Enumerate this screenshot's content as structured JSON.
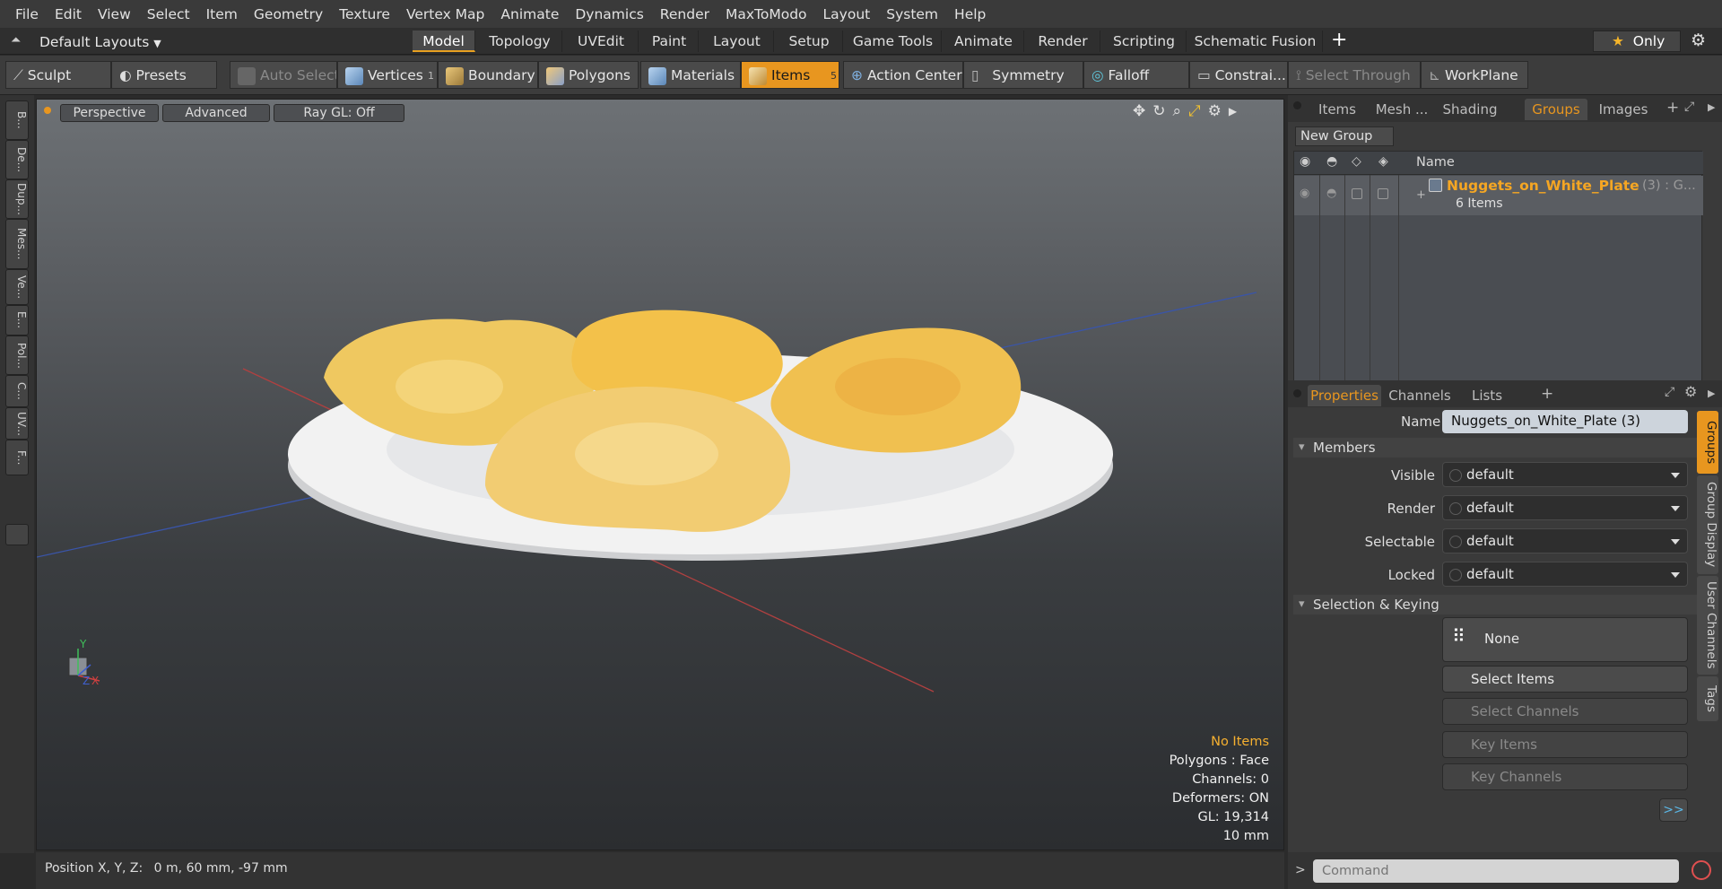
{
  "menu": [
    "File",
    "Edit",
    "View",
    "Select",
    "Item",
    "Geometry",
    "Texture",
    "Vertex Map",
    "Animate",
    "Dynamics",
    "Render",
    "MaxToModo",
    "Layout",
    "System",
    "Help"
  ],
  "layout_bar": {
    "layout_name": "Default Layouts",
    "tabs": [
      "Model",
      "Topology",
      "UVEdit",
      "Paint",
      "Layout",
      "Setup",
      "Game Tools",
      "Animate",
      "Render",
      "Scripting",
      "Schematic Fusion"
    ],
    "active_tab": "Model",
    "plus_label": "+",
    "only_label": "Only"
  },
  "toolbar": {
    "sculpt": "Sculpt",
    "presets": "Presets",
    "auto_select": "Auto Select",
    "vertices": "Vertices",
    "vertices_count": "1",
    "boundary": "Boundary",
    "polygons": "Polygons",
    "materials": "Materials",
    "items": "Items",
    "items_count": "5",
    "action_center": "Action Center",
    "symmetry": "Symmetry",
    "falloff": "Falloff",
    "constraints": "Constrai...",
    "select_through": "Select Through",
    "workplane": "WorkPlane"
  },
  "left_tabs": [
    "B...",
    "De...",
    "Dup...",
    "Mes...",
    "Ve...",
    "E...",
    "Pol...",
    "C...",
    "UV...",
    "F..."
  ],
  "viewport": {
    "perspective": "Perspective",
    "advanced": "Advanced",
    "raygl": "Ray GL: Off",
    "stats": {
      "no_items": "No Items",
      "polygons": "Polygons : Face",
      "channels": "Channels: 0",
      "deformers": "Deformers: ON",
      "gl": "GL: 19,314",
      "scale": "10 mm"
    },
    "axis_x": "X",
    "axis_y": "Y",
    "axis_z": "Z"
  },
  "status": {
    "position_label": "Position X, Y, Z:",
    "position_value": "0 m, 60 mm, -97 mm"
  },
  "right_panel": {
    "top_tabs": [
      "Items",
      "Mesh ...",
      "Shading",
      "Groups",
      "Images"
    ],
    "active_top_tab": "Groups",
    "new_group": "New Group",
    "name_header": "Name",
    "group": {
      "name": "Nuggets_on_White_Plate",
      "suffix": "(3) : G...",
      "items": "6 Items"
    },
    "prop_tabs": [
      "Properties",
      "Channels",
      "Lists"
    ],
    "active_prop_tab": "Properties",
    "name_label": "Name",
    "name_value": "Nuggets_on_White_Plate (3)",
    "members_section": "Members",
    "members": [
      {
        "label": "Visible",
        "value": "default"
      },
      {
        "label": "Render",
        "value": "default"
      },
      {
        "label": "Selectable",
        "value": "default"
      },
      {
        "label": "Locked",
        "value": "default"
      }
    ],
    "sel_section": "Selection & Keying",
    "none_label": "None",
    "select_items": "Select Items",
    "select_channels": "Select Channels",
    "key_items": "Key Items",
    "key_channels": "Key Channels",
    "more": ">>",
    "side_tabs": [
      "Groups",
      "Group Display",
      "User Channels",
      "Tags"
    ],
    "command_placeholder": "Command"
  },
  "colors": {
    "accent": "#e8961f",
    "group_name": "#f5a623"
  }
}
